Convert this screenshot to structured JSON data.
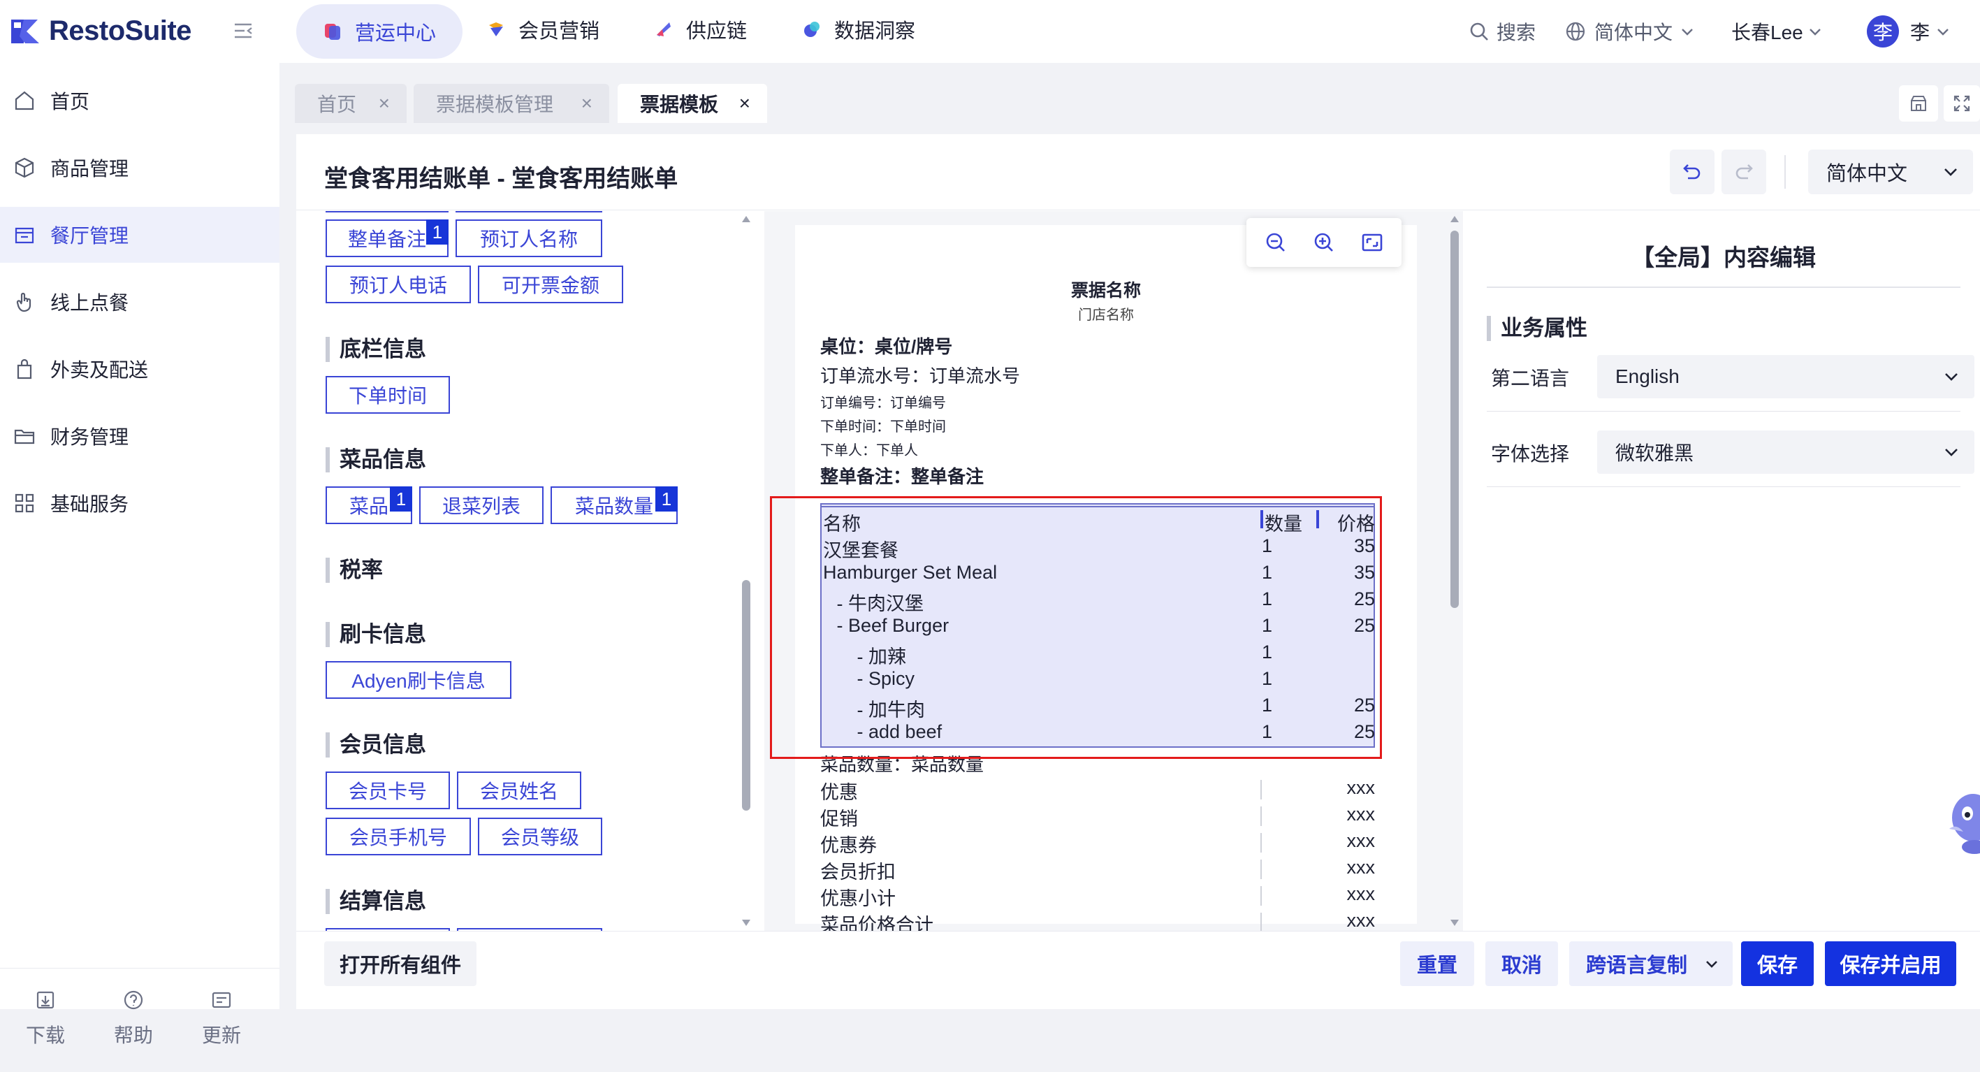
{
  "brand": {
    "name": "RestoSuite"
  },
  "topnav": {
    "tabs": [
      {
        "label": "营运中心",
        "icon": "operations-icon"
      },
      {
        "label": "会员营销",
        "icon": "member-marketing-icon"
      },
      {
        "label": "供应链",
        "icon": "supply-chain-icon"
      },
      {
        "label": "数据洞察",
        "icon": "data-insight-icon"
      }
    ],
    "search_label": "搜索",
    "language": "简体中文",
    "store": "长春Lee",
    "user_avatar": "李",
    "user_name": "李"
  },
  "sidebar": {
    "items": [
      {
        "label": "首页",
        "icon": "home-icon"
      },
      {
        "label": "商品管理",
        "icon": "box-icon"
      },
      {
        "label": "餐厅管理",
        "icon": "store-icon",
        "active": true
      },
      {
        "label": "线上点餐",
        "icon": "hand-pointer-icon"
      },
      {
        "label": "外卖及配送",
        "icon": "bag-icon"
      },
      {
        "label": "财务管理",
        "icon": "folder-icon"
      },
      {
        "label": "基础服务",
        "icon": "grid-icon"
      }
    ],
    "bottom": [
      {
        "label": "下载",
        "icon": "download-icon"
      },
      {
        "label": "帮助",
        "icon": "help-icon"
      },
      {
        "label": "更新",
        "icon": "update-icon"
      }
    ]
  },
  "page_tabs": [
    {
      "label": "首页",
      "close": "×"
    },
    {
      "label": "票据模板管理",
      "close": "×"
    },
    {
      "label": "票据模板",
      "close": "×",
      "active": true
    }
  ],
  "header": {
    "title": "堂食客用结账单 - 堂食客用结账单",
    "language": "简体中文"
  },
  "components": {
    "sections": [
      {
        "title": "底栏信息",
        "chips": [
          "下单时间"
        ]
      },
      {
        "title": "菜品信息",
        "chips": [
          "菜品",
          "退菜列表",
          "菜品数量"
        ]
      },
      {
        "title": "税率",
        "chips": []
      },
      {
        "title": "刷卡信息",
        "chips": [
          "Adyen刷卡信息"
        ]
      },
      {
        "title": "会员信息",
        "chips": [
          "会员卡号",
          "会员姓名",
          "会员手机号",
          "会员等级"
        ]
      },
      {
        "title": "结算信息",
        "chips": []
      }
    ],
    "top_chips": [
      "整单备注",
      "预订人名称",
      "预订人电话",
      "可开票金额"
    ],
    "badge": "1"
  },
  "receipt": {
    "title": "票据名称",
    "store_name": "门店名称",
    "table": "桌位：桌位/牌号",
    "serial": "订单流水号：订单流水号",
    "order_no": "订单编号：订单编号",
    "order_time": "下单时间：下单时间",
    "orderer": "下单人：下单人",
    "note": "整单备注：整单备注",
    "columns": {
      "name": "名称",
      "qty": "数量",
      "price": "价格"
    },
    "rows": [
      {
        "name": "汉堡套餐",
        "qty": "1",
        "price": "35"
      },
      {
        "name": "Hamburger Set Meal",
        "qty": "1",
        "price": "35"
      },
      {
        "name": " - 牛肉汉堡",
        "qty": "1",
        "price": "25"
      },
      {
        "name": " - Beef Burger",
        "qty": "1",
        "price": "25"
      },
      {
        "name": "   - 加辣",
        "qty": "1",
        "price": ""
      },
      {
        "name": "   - Spicy",
        "qty": "1",
        "price": ""
      },
      {
        "name": "   - 加牛肉",
        "qty": "1",
        "price": "25"
      },
      {
        "name": "   - add beef",
        "qty": "1",
        "price": "25"
      }
    ],
    "item_count": "菜品数量：菜品数量",
    "summary": [
      {
        "label": "优惠",
        "value": "xxx"
      },
      {
        "label": "促销",
        "value": "xxx"
      },
      {
        "label": "优惠券",
        "value": "xxx"
      },
      {
        "label": "会员折扣",
        "value": "xxx"
      },
      {
        "label": "优惠小计",
        "value": "xxx"
      },
      {
        "label": "菜品价格合计",
        "value": "xxx"
      }
    ]
  },
  "right_panel": {
    "title": "【全局】内容编辑",
    "section": "业务属性",
    "fields": [
      {
        "label": "第二语言",
        "value": "English"
      },
      {
        "label": "字体选择",
        "value": "微软雅黑"
      }
    ]
  },
  "footer": {
    "open_all": "打开所有组件",
    "reset": "重置",
    "cancel": "取消",
    "cross_copy": "跨语言复制",
    "save": "保存",
    "save_enable": "保存并启用"
  },
  "colors": {
    "accent": "#3a45d6",
    "primary": "#1432e0",
    "highlight": "#e31b1b"
  }
}
